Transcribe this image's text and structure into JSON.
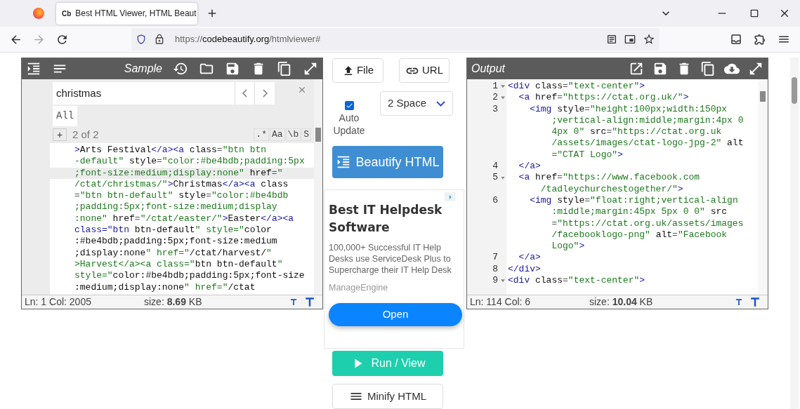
{
  "browser": {
    "tab": {
      "favicon": "Cb",
      "title": "Best HTML Viewer, HTML Beaut"
    },
    "url": {
      "scheme": "https://",
      "host": "codebeautify.org",
      "path": "/htmlviewer#"
    }
  },
  "input_editor": {
    "title": "Sample",
    "search": {
      "query": "christmas",
      "all_button": "All",
      "add_button": "+",
      "count": "2 of 2",
      "options": [
        ".*",
        "Aa",
        "\\b",
        "S"
      ]
    },
    "lines": [
      {
        "text": ">Arts Festival</a><a class=\"btn btn",
        "active": false
      },
      {
        "text": "-default\" style=\"color:#be4bdb;padding:5px",
        "active": false
      },
      {
        "text": ";font-size:medium;display:none\" href=\"",
        "active": true
      },
      {
        "text": "/ctat/christmas/\">Christmas</a><a class",
        "active": false
      },
      {
        "text": "=\"btn btn-default\" style=\"color:#be4bdb",
        "active": false
      },
      {
        "text": ";padding:5px;font-size:medium;display",
        "active": false
      },
      {
        "text": ":none\" href=\"/ctat/easter/\">Easter</a><a",
        "active": false
      },
      {
        "text": "class=\"btn btn-default\" style=\"color",
        "active": false
      },
      {
        "text": ":#be4bdb;padding:5px;font-size:medium",
        "active": false
      },
      {
        "text": ";display:none\" href=\"/ctat/harvest/\"",
        "active": false
      },
      {
        "text": ">Harvest</a><a class=\"btn btn-default\"",
        "active": false
      },
      {
        "text": "style=\"color:#be4bdb;padding:5px;font-size",
        "active": false
      },
      {
        "text": ":medium;display:none\" href=\"/ctat",
        "active": false
      }
    ],
    "status": {
      "position": "Ln: 1 Col: 2005",
      "size": "size: **8.69** KB"
    }
  },
  "controls": {
    "file_button": "File",
    "url_button": "URL",
    "auto_update": {
      "label": "Auto Update",
      "checked": true
    },
    "indent_select": "2 Space",
    "beautify_button": "Beautify HTML",
    "run_button": "Run / View",
    "minify_button": "Minify HTML"
  },
  "ad": {
    "title": "Best IT Helpdesk Software",
    "body": "100,000+ Successful IT Help Desks use ServiceDesk Plus to Supercharge their IT Help Desk",
    "advertiser": "ManageEngine",
    "button": "Open"
  },
  "output_editor": {
    "title": "Output",
    "lines": [
      {
        "number": "1",
        "foldable": true,
        "text": "<div class=\"text-center\">"
      },
      {
        "number": "2",
        "foldable": true,
        "text": "  <a href=\"https://ctat.org.uk/\">"
      },
      {
        "number": "3",
        "foldable": false,
        "text": "    <img style=\"height:100px;width:150px",
        "wraps": [
          ";vertical-align:middle;margin:4px 0",
          "4px 0\" src=\"https://ctat.org.uk",
          "/assets/images/ctat-logo-jpg-2\" alt",
          "=\"CTAT Logo\">"
        ]
      },
      {
        "number": "4",
        "foldable": false,
        "text": "  </a>"
      },
      {
        "number": "5",
        "foldable": true,
        "text": "  <a href=\"https://www.facebook.com",
        "wraps": [
          "/tadleychurchestogether/\">"
        ]
      },
      {
        "number": "6",
        "foldable": false,
        "text": "    <img style=\"float:right;vertical-align",
        "wraps": [
          ":middle;margin:45px 5px 0 0\" src",
          "=\"https://ctat.org.uk/assets/images",
          "/facebooklogo-png\" alt=\"Facebook",
          "Logo\">"
        ]
      },
      {
        "number": "7",
        "foldable": false,
        "text": "  </a>"
      },
      {
        "number": "8",
        "foldable": false,
        "text": "</div>"
      },
      {
        "number": "9",
        "foldable": true,
        "text": "<div class=\"text-center\">"
      }
    ],
    "status": {
      "position": "Ln: 114 Col: 6",
      "size": "size: **10.04** KB"
    }
  }
}
